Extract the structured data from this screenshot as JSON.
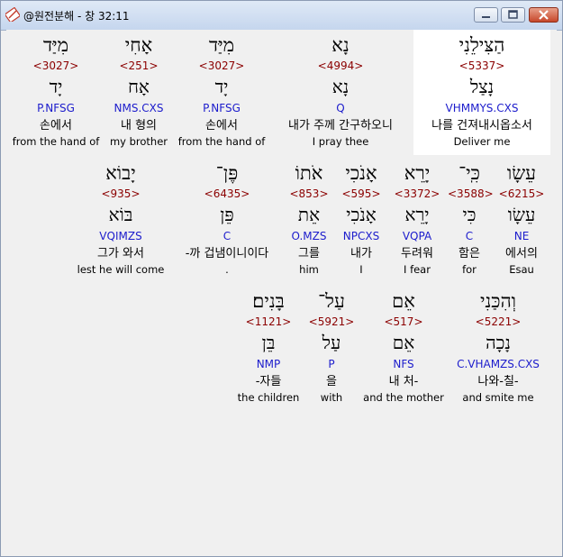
{
  "window": {
    "title": "@원전분해 - 창 32:11"
  },
  "rows": [
    [
      {
        "heb": "הַצִּילֵנִי",
        "num": "<5337>",
        "root": "נָצַל",
        "parse": "VHMMYS.CXS",
        "kor": "나를 건져내시옵소서",
        "eng": "Deliver me"
      },
      {
        "heb": "נָא",
        "num": "<4994>",
        "root": "נָא",
        "parse": "Q",
        "kor": "내가 주께 간구하오니",
        "eng": "I pray thee"
      },
      {
        "heb": "מִיַּד",
        "num": "<3027>",
        "root": "יָד",
        "parse": "P.NFSG",
        "kor": "손에서",
        "eng": "from the hand of"
      },
      {
        "heb": "אָחִי",
        "num": "<251>",
        "root": "אָח",
        "parse": "NMS.CXS",
        "kor": "내 형의",
        "eng": "my brother"
      },
      {
        "heb": "מִיַּד",
        "num": "<3027>",
        "root": "יָד",
        "parse": "P.NFSG",
        "kor": "손에서",
        "eng": "from the hand of"
      }
    ],
    [
      {
        "heb": "עֵשָׂו",
        "num": "<6215>",
        "root": "עֵשָׂו",
        "parse": "NE",
        "kor": "에서의",
        "eng": "Esau"
      },
      {
        "heb": "כִּֽי־",
        "num": "<3588>",
        "root": "כִּי",
        "parse": "C",
        "kor": "함은",
        "eng": "for"
      },
      {
        "heb": "יָרֵא",
        "num": "<3372>",
        "root": "יָרֵא",
        "parse": "VQPA",
        "kor": "두려워",
        "eng": "I fear"
      },
      {
        "heb": "אָנֹכִי",
        "num": "<595>",
        "root": "אָנֹכִי",
        "parse": "NPCXS",
        "kor": "내가",
        "eng": "I"
      },
      {
        "heb": "אֹתוֹ",
        "num": "<853>",
        "root": "אֵת",
        "parse": "O.MZS",
        "kor": "그를",
        "eng": "him"
      },
      {
        "heb": "פֶּן־",
        "num": "<6435>",
        "root": "פֵּן",
        "parse": "C",
        "kor": "-까 겁냄이니이다",
        "eng": "."
      },
      {
        "heb": "יָבוֹא",
        "num": "<935>",
        "root": "בּוֹא",
        "parse": "VQIMZS",
        "kor": "그가 와서",
        "eng": "lest he will come"
      }
    ],
    [
      {
        "heb": "וְהִכַּנִי",
        "num": "<5221>",
        "root": "נָכָה",
        "parse": "C.VHAMZS.CXS",
        "kor": "나와-칠-",
        "eng": "and smite me"
      },
      {
        "heb": "אֵם",
        "num": "<517>",
        "root": "אֵם",
        "parse": "NFS",
        "kor": "내 처-",
        "eng": "and the mother"
      },
      {
        "heb": "עַל־",
        "num": "<5921>",
        "root": "עַל",
        "parse": "P",
        "kor": "을",
        "eng": "with"
      },
      {
        "heb": "בָּנִים׃",
        "num": "<1121>",
        "root": "בֵּן",
        "parse": "NMP",
        "kor": "-자들",
        "eng": "the children"
      }
    ]
  ]
}
